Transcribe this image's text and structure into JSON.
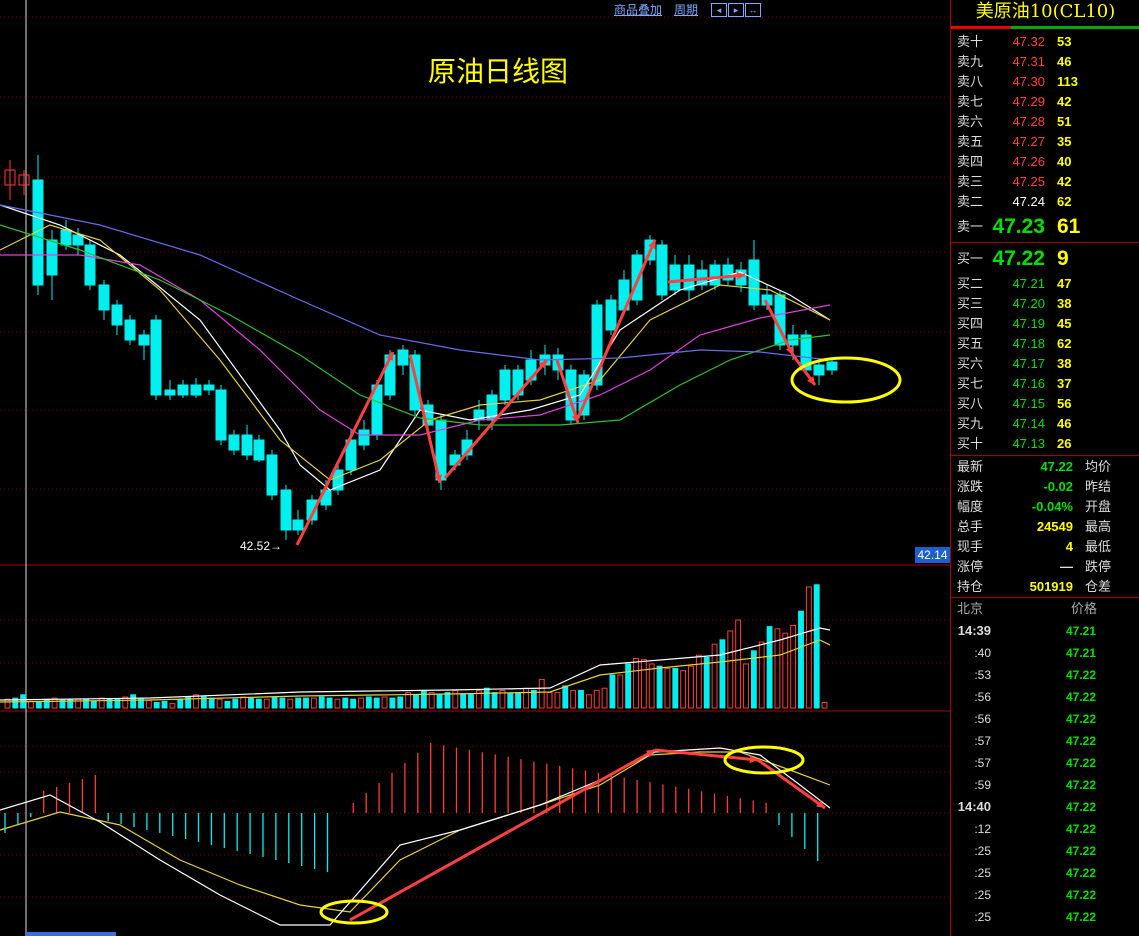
{
  "toolbar": {
    "overlay_label": "商品叠加",
    "period_label": "周期"
  },
  "chart": {
    "title": "原油日线图",
    "low_label": "42.52→",
    "price_tag": "42.14",
    "colors": {
      "up": "#ff3b3b",
      "down": "#00f0f0",
      "annot": "#ff4040",
      "circle": "#ffff00"
    }
  },
  "quote": {
    "symbol": "美原油10(CL10)",
    "asks": [
      {
        "label": "卖十",
        "price": "47.32",
        "vol": "53"
      },
      {
        "label": "卖九",
        "price": "47.31",
        "vol": "46"
      },
      {
        "label": "卖八",
        "price": "47.30",
        "vol": "113"
      },
      {
        "label": "卖七",
        "price": "47.29",
        "vol": "42"
      },
      {
        "label": "卖六",
        "price": "47.28",
        "vol": "51"
      },
      {
        "label": "卖五",
        "price": "47.27",
        "vol": "35"
      },
      {
        "label": "卖四",
        "price": "47.26",
        "vol": "40"
      },
      {
        "label": "卖三",
        "price": "47.25",
        "vol": "42"
      },
      {
        "label": "卖二",
        "price": "47.24",
        "vol": "62"
      }
    ],
    "ask1": {
      "label": "卖一",
      "price": "47.23",
      "vol": "61"
    },
    "bid1": {
      "label": "买一",
      "price": "47.22",
      "vol": "9"
    },
    "bids": [
      {
        "label": "买二",
        "price": "47.21",
        "vol": "47"
      },
      {
        "label": "买三",
        "price": "47.20",
        "vol": "38"
      },
      {
        "label": "买四",
        "price": "47.19",
        "vol": "45"
      },
      {
        "label": "买五",
        "price": "47.18",
        "vol": "62"
      },
      {
        "label": "买六",
        "price": "47.17",
        "vol": "38"
      },
      {
        "label": "买七",
        "price": "47.16",
        "vol": "37"
      },
      {
        "label": "买八",
        "price": "47.15",
        "vol": "56"
      },
      {
        "label": "买九",
        "price": "47.14",
        "vol": "46"
      },
      {
        "label": "买十",
        "price": "47.13",
        "vol": "26"
      }
    ],
    "stats": [
      {
        "l": "最新",
        "v": "47.22",
        "r": "均价",
        "color": "#00e000"
      },
      {
        "l": "涨跌",
        "v": "-0.02",
        "r": "昨结",
        "color": "#00e000"
      },
      {
        "l": "幅度",
        "v": "-0.04%",
        "r": "开盘",
        "color": "#00e000"
      },
      {
        "l": "总手",
        "v": "24549",
        "r": "最高",
        "color": "#ffff00"
      },
      {
        "l": "现手",
        "v": "4",
        "r": "最低",
        "color": "#ffff00"
      },
      {
        "l": "涨停",
        "v": "—",
        "r": "跌停",
        "color": "#dddddd"
      },
      {
        "l": "持仓",
        "v": "501919",
        "r": "仓差",
        "color": "#ffff00"
      }
    ],
    "ticks_header": {
      "place": "北京",
      "price": "价格"
    },
    "ticks": [
      {
        "t": "14:39",
        "p": "47.21",
        "big": true
      },
      {
        "t": ":40",
        "p": "47.21"
      },
      {
        "t": ":53",
        "p": "47.22"
      },
      {
        "t": ":56",
        "p": "47.22"
      },
      {
        "t": ":56",
        "p": "47.22"
      },
      {
        "t": ":57",
        "p": "47.22"
      },
      {
        "t": ":57",
        "p": "47.22"
      },
      {
        "t": ":59",
        "p": "47.22"
      },
      {
        "t": "14:40",
        "p": "47.22",
        "big": true
      },
      {
        "t": ":12",
        "p": "47.22"
      },
      {
        "t": ":25",
        "p": "47.22"
      },
      {
        "t": ":25",
        "p": "47.22"
      },
      {
        "t": ":25",
        "p": "47.22"
      },
      {
        "t": ":25",
        "p": "47.22"
      }
    ]
  }
}
